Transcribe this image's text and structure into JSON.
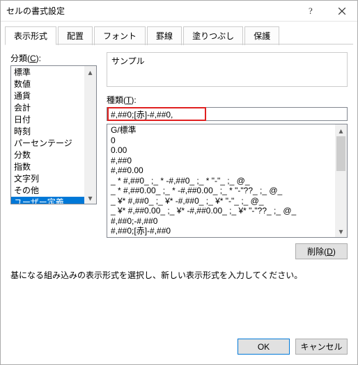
{
  "window": {
    "title": "セルの書式設定"
  },
  "tabs": [
    "表示形式",
    "配置",
    "フォント",
    "罫線",
    "塗りつぶし",
    "保護"
  ],
  "category": {
    "label_pre": "分類(",
    "label_key": "C",
    "label_post": "):",
    "items": [
      "標準",
      "数値",
      "通貨",
      "会計",
      "日付",
      "時刻",
      "パーセンテージ",
      "分数",
      "指数",
      "文字列",
      "その他",
      "ユーザー定義"
    ],
    "selected_index": 11
  },
  "sample": {
    "label": "サンプル",
    "value": ""
  },
  "type": {
    "label_pre": "種類(",
    "label_key": "T",
    "label_post": "):",
    "value": "#,##0;[赤]-#,##0,"
  },
  "formats": [
    "G/標準",
    "0",
    "0.00",
    "#,##0",
    "#,##0.00",
    "_ * #,##0_ ;_ * -#,##0_ ;_ * \"-\"_ ;_ @_ ",
    "_ * #,##0.00_ ;_ * -#,##0.00_ ;_ * \"-\"??_ ;_ @_ ",
    "_ ¥* #,##0_ ;_ ¥* -#,##0_ ;_ ¥* \"-\"_ ;_ @_ ",
    "_ ¥* #,##0.00_ ;_ ¥* -#,##0.00_ ;_ ¥* \"-\"??_ ;_ @_ ",
    "#,##0;-#,##0",
    "#,##0;[赤]-#,##0"
  ],
  "delete": {
    "pre": "削除(",
    "key": "D",
    "post": ")"
  },
  "hint": "基になる組み込みの表示形式を選択し、新しい表示形式を入力してください。",
  "buttons": {
    "ok": "OK",
    "cancel": "キャンセル"
  }
}
